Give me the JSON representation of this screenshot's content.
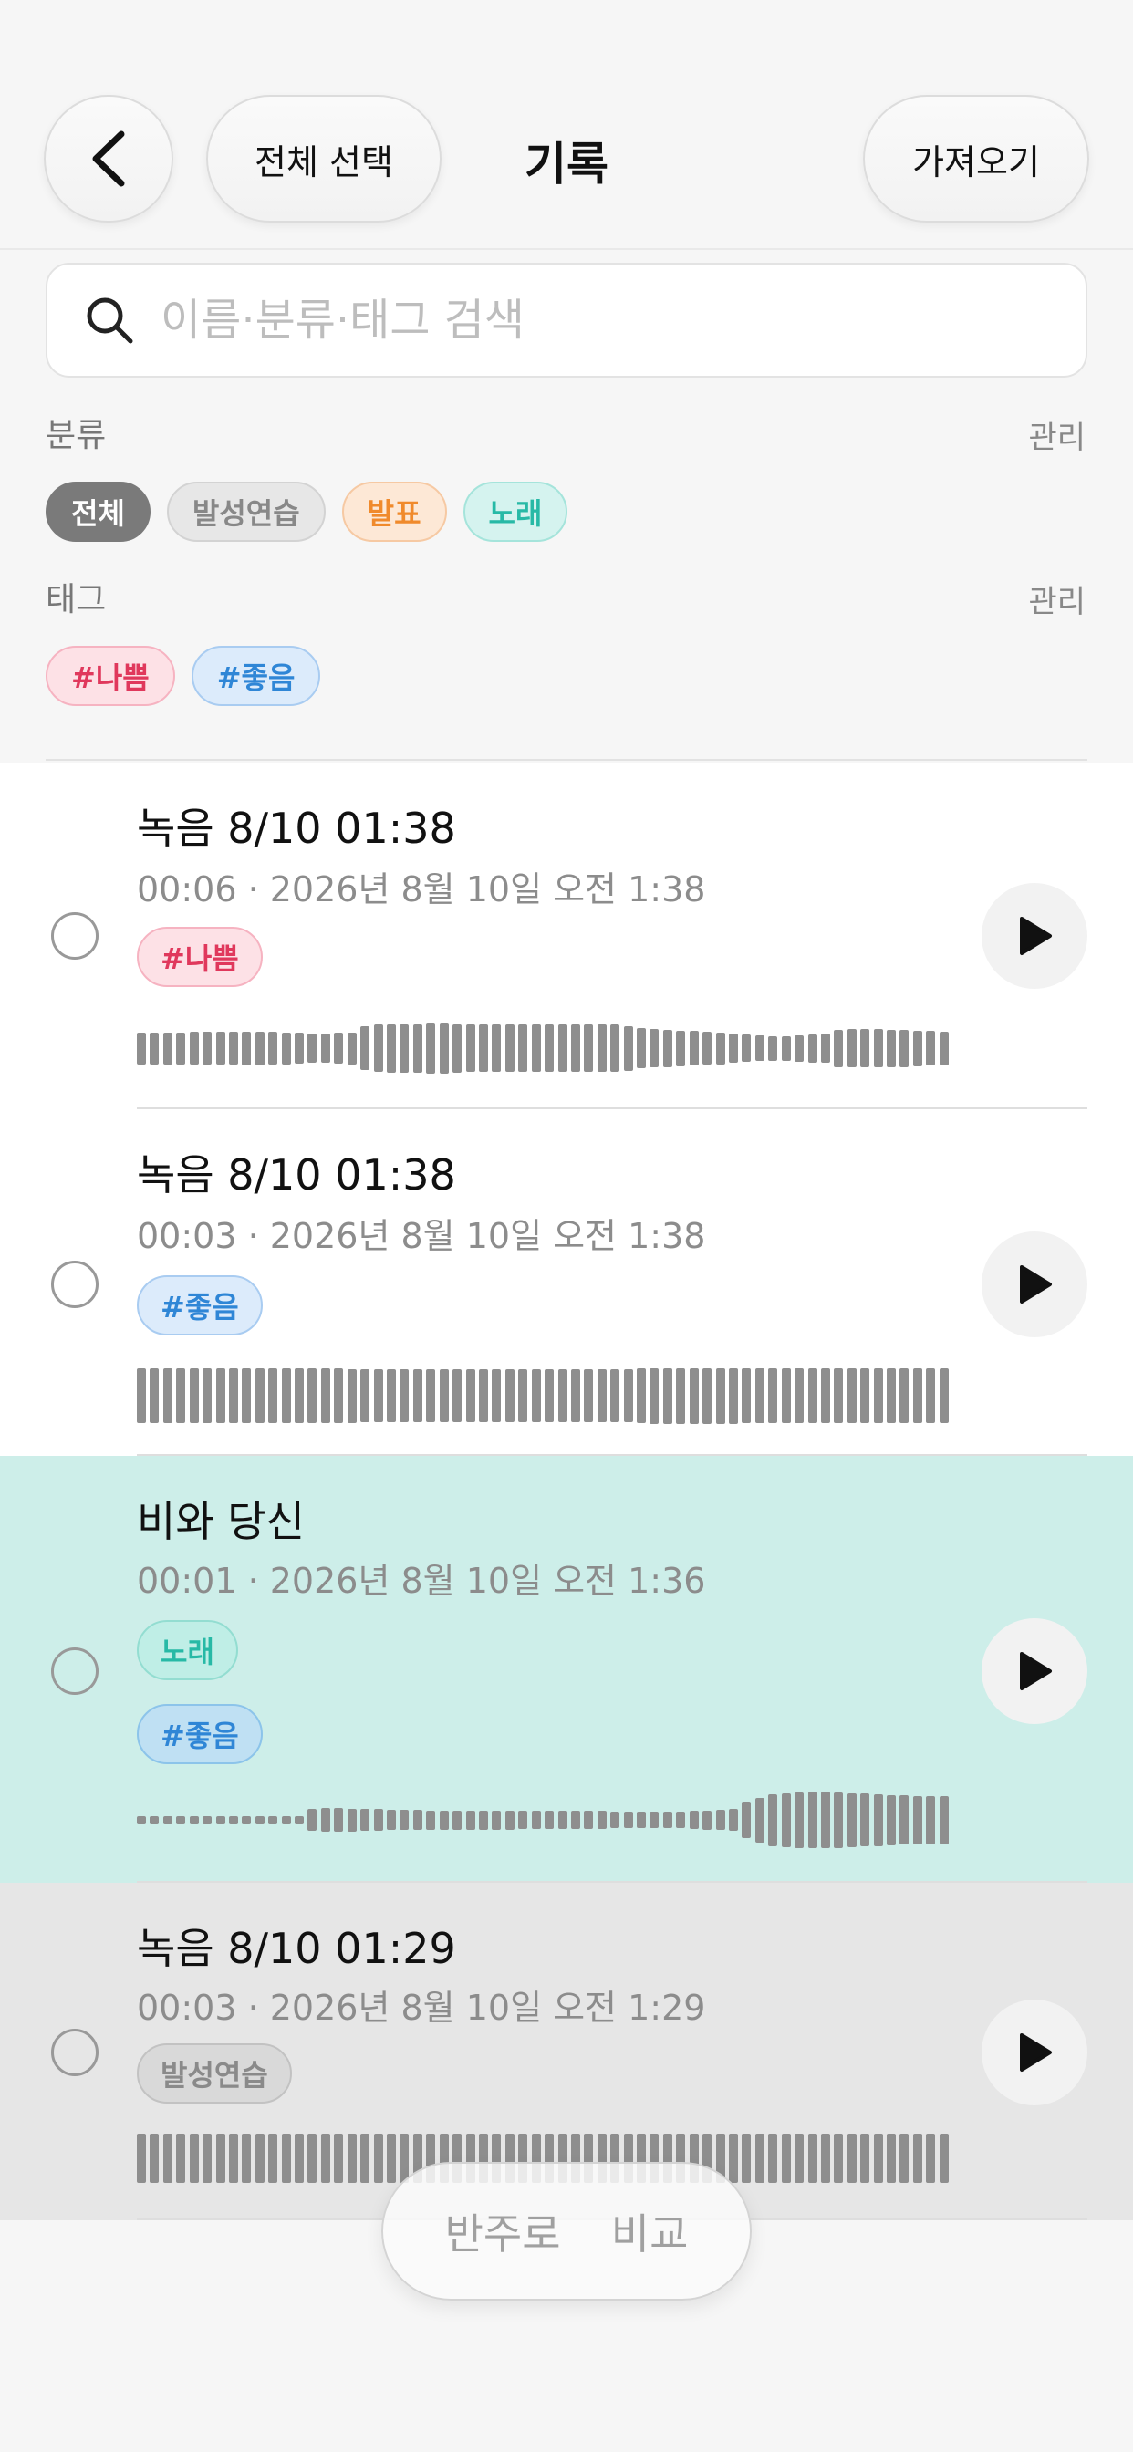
{
  "header": {
    "title": "기록",
    "select_all_label": "전체 선택",
    "import_label": "가져오기"
  },
  "search": {
    "placeholder": "이름·분류·태그 검색"
  },
  "categories": {
    "label": "분류",
    "manage_label": "관리",
    "items": [
      {
        "label": "전체",
        "bg": "#7a7a7a",
        "fg": "#ffffff",
        "border": "#7a7a7a"
      },
      {
        "label": "발성연습",
        "bg": "#e7e7e7",
        "fg": "#888888",
        "border": "#d3d3d3"
      },
      {
        "label": "발표",
        "bg": "#fde8d6",
        "fg": "#f08a2c",
        "border": "#f6c9a3"
      },
      {
        "label": "노래",
        "bg": "#d5f3ef",
        "fg": "#27b9a6",
        "border": "#a5e4db"
      }
    ]
  },
  "tags": {
    "label": "태그",
    "manage_label": "관리",
    "items": [
      {
        "label": "#나쁨",
        "bg": "#fde1e6",
        "fg": "#e0385c",
        "border": "#f6b3c1"
      },
      {
        "label": "#좋음",
        "bg": "#dcebfb",
        "fg": "#2f86d6",
        "border": "#a9ccf1"
      }
    ]
  },
  "recordings": [
    {
      "title": "녹음 8/10 01:38",
      "meta": "00:06 · 2026년 8월 10일 오전 1:38",
      "chips": [
        {
          "label": "#나쁨",
          "bg": "#fde1e6",
          "fg": "#e0385c",
          "border": "#f6b3c1"
        }
      ],
      "row_bg": "#ffffff",
      "waveform": [
        0.6,
        0.6,
        0.6,
        0.6,
        0.62,
        0.62,
        0.62,
        0.62,
        0.64,
        0.64,
        0.62,
        0.6,
        0.58,
        0.56,
        0.56,
        0.58,
        0.6,
        0.82,
        0.9,
        0.92,
        0.92,
        0.92,
        0.94,
        0.94,
        0.92,
        0.9,
        0.9,
        0.9,
        0.9,
        0.9,
        0.9,
        0.9,
        0.9,
        0.9,
        0.9,
        0.9,
        0.9,
        0.85,
        0.75,
        0.72,
        0.7,
        0.68,
        0.66,
        0.62,
        0.6,
        0.56,
        0.52,
        0.48,
        0.46,
        0.46,
        0.5,
        0.54,
        0.56,
        0.7,
        0.72,
        0.72,
        0.72,
        0.7,
        0.7,
        0.68,
        0.66,
        0.64
      ]
    },
    {
      "title": "녹음 8/10 01:38",
      "meta": "00:03 · 2026년 8월 10일 오전 1:38",
      "chips": [
        {
          "label": "#좋음",
          "bg": "#dcebfb",
          "fg": "#2f86d6",
          "border": "#a9ccf1"
        }
      ],
      "row_bg": "#ffffff",
      "waveform": [
        0.94,
        0.94,
        0.94,
        0.94,
        0.94,
        0.94,
        0.94,
        0.94,
        0.94,
        0.94,
        0.94,
        0.94,
        0.94,
        0.94,
        0.94,
        0.94,
        0.92,
        0.9,
        0.9,
        0.9,
        0.9,
        0.9,
        0.9,
        0.9,
        0.9,
        0.9,
        0.9,
        0.9,
        0.9,
        0.9,
        0.9,
        0.9,
        0.9,
        0.9,
        0.9,
        0.9,
        0.9,
        0.9,
        0.94,
        0.96,
        0.96,
        0.96,
        0.96,
        0.96,
        0.96,
        0.96,
        0.94,
        0.94,
        0.94,
        0.94,
        0.94,
        0.94,
        0.94,
        0.94,
        0.94,
        0.94,
        0.94,
        0.94,
        0.94,
        0.94,
        0.94,
        0.94
      ]
    },
    {
      "title": "비와 당신",
      "meta": "00:01 · 2026년 8월 10일 오전 1:36",
      "chips": [
        {
          "label": "노래",
          "bg": "#bfeee6",
          "fg": "#27b9a6",
          "border": "#93ddd1"
        },
        {
          "label": "#좋음",
          "bg": "#bfe0f3",
          "fg": "#2f86d6",
          "border": "#8cc4ea"
        }
      ],
      "row_bg": "#cdeee9",
      "waveform": [
        0.14,
        0.14,
        0.14,
        0.14,
        0.14,
        0.14,
        0.14,
        0.14,
        0.14,
        0.14,
        0.14,
        0.14,
        0.14,
        0.36,
        0.4,
        0.4,
        0.38,
        0.36,
        0.36,
        0.34,
        0.34,
        0.34,
        0.32,
        0.32,
        0.32,
        0.32,
        0.32,
        0.32,
        0.32,
        0.3,
        0.3,
        0.3,
        0.3,
        0.3,
        0.3,
        0.3,
        0.28,
        0.28,
        0.28,
        0.28,
        0.28,
        0.28,
        0.3,
        0.32,
        0.34,
        0.36,
        0.6,
        0.74,
        0.86,
        0.9,
        0.92,
        0.94,
        0.94,
        0.92,
        0.9,
        0.88,
        0.86,
        0.84,
        0.82,
        0.8,
        0.8,
        0.8
      ]
    },
    {
      "title": "녹음 8/10 01:29",
      "meta": "00:03 · 2026년 8월 10일 오전 1:29",
      "chips": [
        {
          "label": "발성연습",
          "bg": "#d9d9d9",
          "fg": "#8a8a8a",
          "border": "#c2c2c2"
        }
      ],
      "row_bg": "#e6e6e6",
      "waveform": [
        0.9,
        0.9,
        0.9,
        0.9,
        0.9,
        0.9,
        0.9,
        0.9,
        0.9,
        0.9,
        0.9,
        0.9,
        0.9,
        0.9,
        0.9,
        0.9,
        0.9,
        0.9,
        0.9,
        0.9,
        0.9,
        0.9,
        0.9,
        0.9,
        0.9,
        0.9,
        0.9,
        0.9,
        0.9,
        0.9,
        0.9,
        0.9,
        0.9,
        0.9,
        0.9,
        0.9,
        0.9,
        0.9,
        0.9,
        0.9,
        0.9,
        0.9,
        0.9,
        0.9,
        0.9,
        0.9,
        0.9,
        0.9,
        0.9,
        0.9,
        0.9,
        0.9,
        0.9,
        0.9,
        0.9,
        0.9,
        0.9,
        0.9,
        0.9,
        0.9,
        0.9,
        0.9
      ]
    }
  ],
  "bottom_bar": {
    "accompaniment_label": "반주로",
    "compare_label": "비교"
  },
  "colors": {
    "background": "#f6f6f6",
    "waveform": "#8e8e8e",
    "play_icon": "#111111"
  }
}
